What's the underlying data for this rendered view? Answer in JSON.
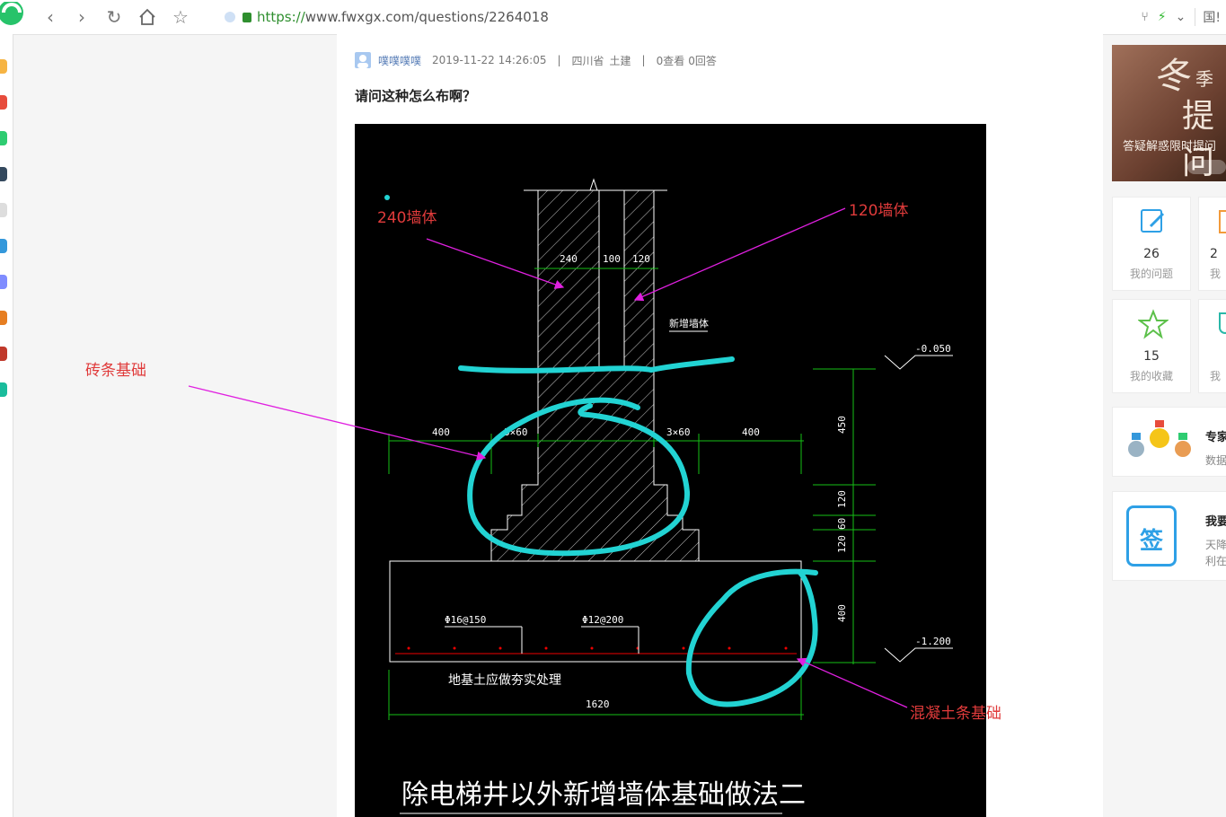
{
  "browser": {
    "url_scheme": "https://",
    "url_rest": "www.fwxgx.com/questions/2264018",
    "right_text": "国!"
  },
  "question": {
    "author": "噗噗噗噗",
    "datetime": "2019-11-22 14:26:05",
    "sep1": "|",
    "location": "四川省",
    "category": "土建",
    "sep2": "|",
    "views": "0查看",
    "answers": "0回答",
    "title": "请问这种怎么布啊？"
  },
  "drawing": {
    "label_240_wall": "240墙体",
    "label_120_wall": "120墙体",
    "label_brick_foundation": "砖条基础",
    "label_concrete_foundation": "混凝土条基础",
    "dim_240": "240",
    "dim_100": "100",
    "dim_120": "120",
    "dim_400_left": "400",
    "dim_3x60_left": "3×60",
    "dim_3x60_right": "3×60",
    "dim_400_right": "400",
    "dim_1620": "1620",
    "dim_450": "450",
    "dim_120a": "120",
    "dim_60": "60",
    "dim_120b": "120",
    "dim_400_v": "400",
    "elev_top": "-0.050",
    "elev_bottom": "-1.200",
    "new_wall": "新增墙体",
    "rebar_1": "Φ16@150",
    "rebar_2": "Φ12@200",
    "soil_note": "地基土应做夯实处理",
    "caption": "除电梯井以外新增墙体基础做法二"
  },
  "sidebar_right": {
    "banner_big1": "冬",
    "banner_small": "季",
    "banner_big2": "提问",
    "banner_sub": "答疑解惑限时提问",
    "card1_num": "26",
    "card1_label": "我的问题",
    "card2_num": "2",
    "card2_label": "我",
    "card3_num": "15",
    "card3_label": "我的收藏",
    "card4_label": "我",
    "card5_title": "专家",
    "card5_sub": "数据",
    "card6_title": "我要",
    "card6_sub1": "天降",
    "card6_sub2": "利在",
    "sign_char": "签"
  },
  "colors": {
    "annotation_red": "#e03b3b",
    "arrow_magenta": "#e020e0",
    "highlight_cyan": "#22d3d3",
    "cad_green": "#16c016",
    "cad_white": "#ffffff",
    "url_green": "#2f8f2f"
  }
}
